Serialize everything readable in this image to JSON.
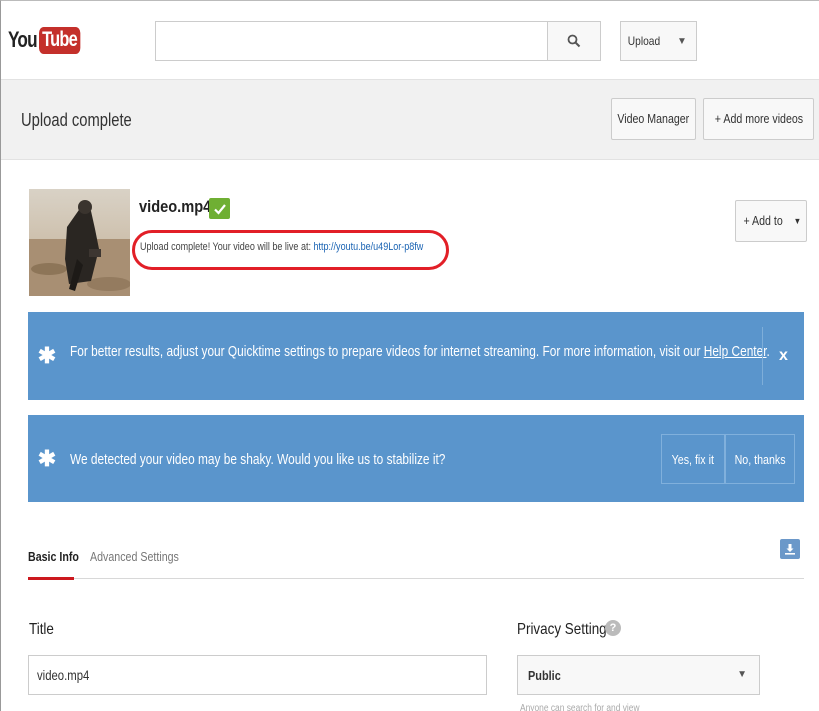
{
  "header": {
    "logo_you": "You",
    "logo_tube": "Tube",
    "search_placeholder": "",
    "upload_label": "Upload"
  },
  "subheader": {
    "title": "Upload complete",
    "video_manager_label": "Video Manager",
    "add_more_label": "+ Add more videos"
  },
  "video": {
    "filename": "video.mp4",
    "status_prefix": "Upload complete! Your video will be live at: ",
    "url": "http://youtu.be/u49Lor-p8fw",
    "add_to_label": "+ Add to"
  },
  "banners": [
    {
      "text": "For better results, adjust your Quicktime settings to prepare videos for internet streaming. For more information, visit our ",
      "link": "Help Center",
      "link_suffix": ".",
      "close": "x"
    },
    {
      "text": "We detected your video may be shaky. Would you like us to stabilize it?",
      "yes_label": "Yes, fix it",
      "no_label": "No, thanks"
    }
  ],
  "tabs": [
    {
      "label": "Basic Info",
      "active": true
    },
    {
      "label": "Advanced Settings",
      "active": false
    }
  ],
  "form": {
    "title_label": "Title",
    "title_value": "video.mp4",
    "privacy_label": "Privacy Settings",
    "privacy_value": "Public",
    "privacy_hint": "Anyone can search for and view"
  },
  "colors": {
    "brand_red": "#c4302b",
    "banner_blue": "#5a95cc",
    "success_green": "#6faf33",
    "annotation_red": "#e21f27",
    "link_blue": "#1a63b3"
  }
}
